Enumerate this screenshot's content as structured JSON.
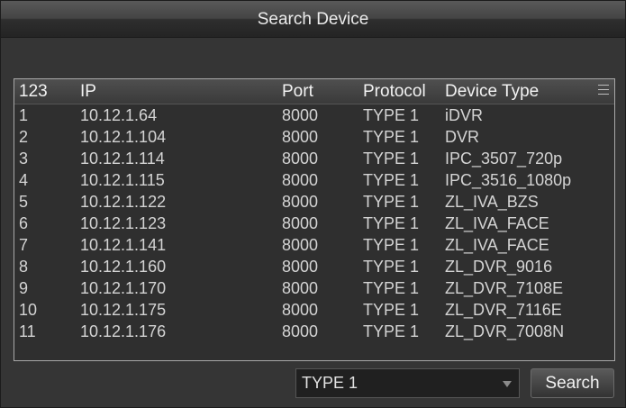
{
  "window": {
    "title": "Search Device"
  },
  "table": {
    "headers": [
      "123",
      "IP",
      "Port",
      "Protocol",
      "Device Type"
    ],
    "rows": [
      [
        "1",
        "10.12.1.64",
        "8000",
        "TYPE 1",
        "iDVR"
      ],
      [
        "2",
        "10.12.1.104",
        "8000",
        "TYPE 1",
        "DVR"
      ],
      [
        "3",
        "10.12.1.114",
        "8000",
        "TYPE 1",
        "IPC_3507_720p"
      ],
      [
        "4",
        "10.12.1.115",
        "8000",
        "TYPE 1",
        "IPC_3516_1080p"
      ],
      [
        "5",
        "10.12.1.122",
        "8000",
        "TYPE 1",
        "ZL_IVA_BZS"
      ],
      [
        "6",
        "10.12.1.123",
        "8000",
        "TYPE 1",
        "ZL_IVA_FACE"
      ],
      [
        "7",
        "10.12.1.141",
        "8000",
        "TYPE 1",
        "ZL_IVA_FACE"
      ],
      [
        "8",
        "10.12.1.160",
        "8000",
        "TYPE 1",
        "ZL_DVR_9016"
      ],
      [
        "9",
        "10.12.1.170",
        "8000",
        "TYPE 1",
        "ZL_DVR_7108E"
      ],
      [
        "10",
        "10.12.1.175",
        "8000",
        "TYPE 1",
        "ZL_DVR_7116E"
      ],
      [
        "11",
        "10.12.1.176",
        "8000",
        "TYPE 1",
        "ZL_DVR_7008N"
      ]
    ],
    "menu_icon": "list-menu-icon"
  },
  "protocol_select": {
    "value": "TYPE 1",
    "icon": "dropdown-arrow-icon"
  },
  "search_button": {
    "label": "Search"
  }
}
